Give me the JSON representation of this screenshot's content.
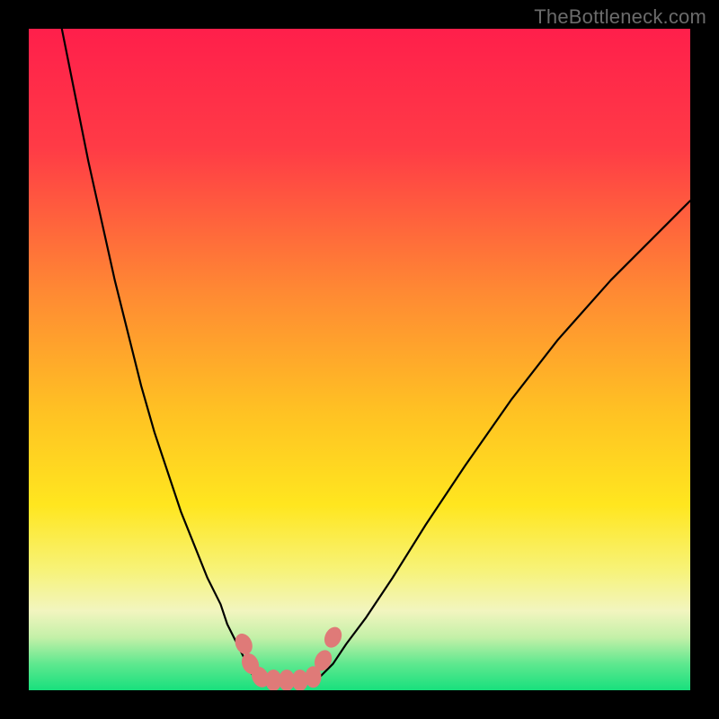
{
  "watermark": "TheBottleneck.com",
  "chart_data": {
    "type": "line",
    "title": "",
    "xlabel": "",
    "ylabel": "",
    "xlim": [
      0,
      100
    ],
    "ylim": [
      0,
      100
    ],
    "grid": false,
    "legend": false,
    "gradient_stops": [
      {
        "offset": 0,
        "color": "#ff1f4b"
      },
      {
        "offset": 18,
        "color": "#ff3b46"
      },
      {
        "offset": 40,
        "color": "#ff8a33"
      },
      {
        "offset": 58,
        "color": "#ffc223"
      },
      {
        "offset": 72,
        "color": "#ffe61f"
      },
      {
        "offset": 82,
        "color": "#f7f37a"
      },
      {
        "offset": 88,
        "color": "#f2f5bf"
      },
      {
        "offset": 92,
        "color": "#c4f0a8"
      },
      {
        "offset": 96,
        "color": "#5fe88f"
      },
      {
        "offset": 100,
        "color": "#18e07d"
      }
    ],
    "series": [
      {
        "name": "left-curve",
        "color": "#000000",
        "x": [
          5,
          7,
          9,
          11,
          13,
          15,
          17,
          19,
          21,
          23,
          25,
          27,
          29,
          30,
          31,
          32,
          33,
          34
        ],
        "y": [
          100,
          90,
          80,
          71,
          62,
          54,
          46,
          39,
          33,
          27,
          22,
          17,
          13,
          10,
          8,
          6,
          4,
          2
        ]
      },
      {
        "name": "right-curve",
        "color": "#000000",
        "x": [
          44,
          46,
          48,
          51,
          55,
          60,
          66,
          73,
          80,
          88,
          96,
          100
        ],
        "y": [
          2,
          4,
          7,
          11,
          17,
          25,
          34,
          44,
          53,
          62,
          70,
          74
        ]
      },
      {
        "name": "floor-segment",
        "color": "#000000",
        "x": [
          34,
          44
        ],
        "y": [
          2,
          2
        ]
      }
    ],
    "markers": {
      "name": "highlight-points",
      "color": "#df7a78",
      "points": [
        {
          "x": 32.5,
          "y": 7
        },
        {
          "x": 33.5,
          "y": 4
        },
        {
          "x": 35,
          "y": 2
        },
        {
          "x": 37,
          "y": 1.5
        },
        {
          "x": 39,
          "y": 1.5
        },
        {
          "x": 41,
          "y": 1.5
        },
        {
          "x": 43,
          "y": 2
        },
        {
          "x": 44.5,
          "y": 4.5
        },
        {
          "x": 46,
          "y": 8
        }
      ]
    }
  }
}
